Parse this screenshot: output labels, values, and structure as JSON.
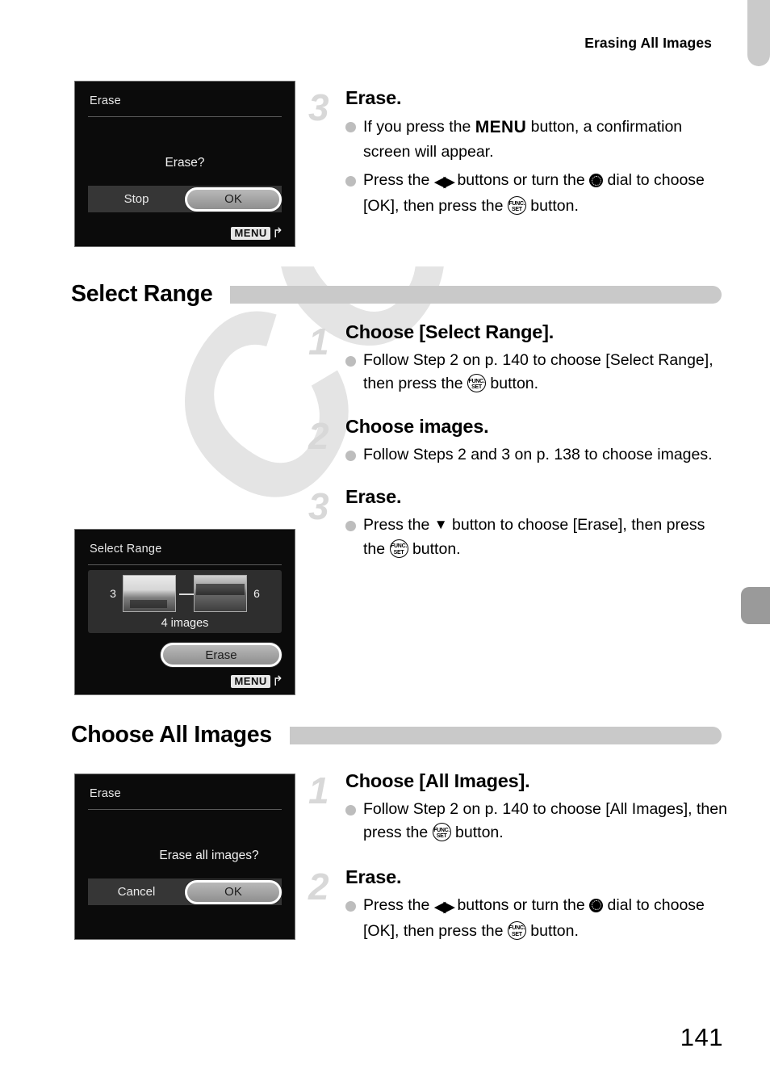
{
  "header": {
    "running_title": "Erasing All Images"
  },
  "watermark": {
    "text": "COPY"
  },
  "page_number": "141",
  "sections": [
    {
      "id": "erase-confirm",
      "heading": null,
      "screen": {
        "name": "erase-confirmation-screen",
        "title": "Erase",
        "prompt": "Erase?",
        "left_button": "Stop",
        "right_button": "OK",
        "menu_badge": "MENU"
      },
      "steps": [
        {
          "number": "3",
          "title": "Erase.",
          "bullets": [
            {
              "parts": [
                {
                  "type": "text",
                  "value": "If you press the "
                },
                {
                  "type": "icon",
                  "name": "menu-icon",
                  "value": "MENU"
                },
                {
                  "type": "text",
                  "value": " button, a confirmation screen will appear."
                }
              ]
            },
            {
              "parts": [
                {
                  "type": "text",
                  "value": "Press the "
                },
                {
                  "type": "icon",
                  "name": "left-right-arrows-icon",
                  "value": "◀▶"
                },
                {
                  "type": "text",
                  "value": " buttons or turn the "
                },
                {
                  "type": "icon",
                  "name": "control-dial-icon",
                  "value": "dial"
                },
                {
                  "type": "text",
                  "value": " dial to choose [OK], then press the "
                },
                {
                  "type": "icon",
                  "name": "func-set-icon",
                  "value": "FUNC. SET"
                },
                {
                  "type": "text",
                  "value": " button."
                }
              ]
            }
          ]
        }
      ]
    },
    {
      "id": "select-range",
      "heading": "Select Range",
      "screen": {
        "name": "select-range-screen",
        "title": "Select Range",
        "start_index": "3",
        "end_index": "6",
        "separator": "—",
        "count_label": "4 images",
        "action_button": "Erase",
        "menu_badge": "MENU"
      },
      "steps": [
        {
          "number": "1",
          "title": "Choose [Select Range].",
          "bullets": [
            {
              "parts": [
                {
                  "type": "text",
                  "value": "Follow Step 2 on p. 140 to choose [Select Range], then press the "
                },
                {
                  "type": "icon",
                  "name": "func-set-icon",
                  "value": "FUNC. SET"
                },
                {
                  "type": "text",
                  "value": " button."
                }
              ]
            }
          ]
        },
        {
          "number": "2",
          "title": "Choose images.",
          "bullets": [
            {
              "parts": [
                {
                  "type": "text",
                  "value": "Follow Steps 2 and 3 on p. 138 to choose images."
                }
              ]
            }
          ]
        },
        {
          "number": "3",
          "title": "Erase.",
          "bullets": [
            {
              "parts": [
                {
                  "type": "text",
                  "value": "Press the "
                },
                {
                  "type": "icon",
                  "name": "down-arrow-icon",
                  "value": "▼"
                },
                {
                  "type": "text",
                  "value": " button to choose [Erase], then press the "
                },
                {
                  "type": "icon",
                  "name": "func-set-icon",
                  "value": "FUNC. SET"
                },
                {
                  "type": "text",
                  "value": " button."
                }
              ]
            }
          ]
        }
      ]
    },
    {
      "id": "choose-all-images",
      "heading": "Choose All Images",
      "screen": {
        "name": "erase-all-screen",
        "title": "Erase",
        "prompt": "Erase all images?",
        "left_button": "Cancel",
        "right_button": "OK"
      },
      "steps": [
        {
          "number": "1",
          "title": "Choose [All Images].",
          "bullets": [
            {
              "parts": [
                {
                  "type": "text",
                  "value": "Follow Step 2 on p. 140 to choose [All Images], then press the "
                },
                {
                  "type": "icon",
                  "name": "func-set-icon",
                  "value": "FUNC. SET"
                },
                {
                  "type": "text",
                  "value": " button."
                }
              ]
            }
          ]
        },
        {
          "number": "2",
          "title": "Erase.",
          "bullets": [
            {
              "parts": [
                {
                  "type": "text",
                  "value": "Press the "
                },
                {
                  "type": "icon",
                  "name": "left-right-arrows-icon",
                  "value": "◀▶"
                },
                {
                  "type": "text",
                  "value": " buttons or turn the "
                },
                {
                  "type": "icon",
                  "name": "control-dial-icon",
                  "value": "dial"
                },
                {
                  "type": "text",
                  "value": " dial to choose [OK], then press the "
                },
                {
                  "type": "icon",
                  "name": "func-set-icon",
                  "value": "FUNC. SET"
                },
                {
                  "type": "text",
                  "value": " button."
                }
              ]
            }
          ]
        }
      ]
    }
  ],
  "icons": {
    "func_line1": "FUNC.",
    "func_line2": "SET",
    "menu_return_arrow": "↰"
  },
  "colors": {
    "tab_light": "#cacaca",
    "tab_dark": "#9a9a9a",
    "heading_bar": "#c9c9c9",
    "step_number": "#d8d8d8",
    "bullet_dot": "#bdbdbd",
    "watermark": "#e4e4e4"
  }
}
